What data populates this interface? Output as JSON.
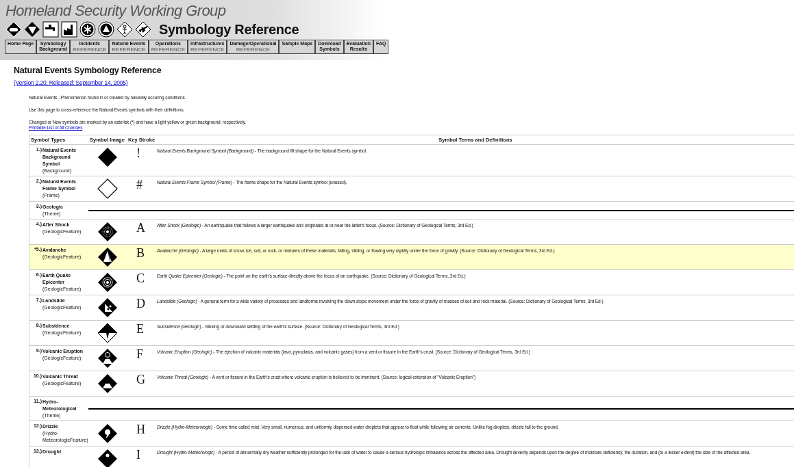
{
  "banner": {
    "title": "Homeland Security Working Group",
    "subtitle": "Symbology Reference"
  },
  "nav": [
    {
      "label": "Home Page"
    },
    {
      "label": "Symbology\nBackground"
    },
    {
      "label": "Incidents",
      "sub": "REFERENCE"
    },
    {
      "label": "Natural Events",
      "sub": "REFERENCE"
    },
    {
      "label": "Operations",
      "sub": "REFERENCE"
    },
    {
      "label": "Infrastructures",
      "sub": "REFERENCE"
    },
    {
      "label": "Damage/Operational",
      "sub": "REFERENCE"
    },
    {
      "label": "Sample Maps"
    },
    {
      "label": "Download\nSymbols"
    },
    {
      "label": "Evaluation\nResults"
    },
    {
      "label": "FAQ"
    }
  ],
  "heading": "Natural Events Symbology Reference",
  "version_link": "(Version 2.20, Released: September 14, 2005)",
  "intro": [
    "Natural Events - Phenomenon found in or created by naturally occuring conditions.",
    "Use this page to cross-reference the Natural Events symbols with their definitions.",
    "Changed or New symbols are marked by an asterisk (*) and have a light yellow or green background, respectively."
  ],
  "changes_link": "Printable List of All Changes",
  "table": {
    "columns": [
      "Symbol Types",
      "Symbol Image",
      "Key Stroke",
      "Symbol Terms and Definitions"
    ],
    "rows": [
      {
        "kind": "symbol",
        "number": "1.)",
        "name": "Natural Events Background Symbol",
        "type": "(Background)",
        "key": "!",
        "changed": false,
        "definition": "*Natural Events Background Symbol (Background)* - The background fill shape for the Natural Events symbol."
      },
      {
        "kind": "symbol",
        "number": "2.)",
        "name": "Natural Events Frame Symbol",
        "type": "(Frame)",
        "key": "#",
        "changed": false,
        "definition": "*Natural Events Frame Symbol (Frame)* - The frame shape for the Natural Events symbol (unused)."
      },
      {
        "kind": "theme",
        "number": "3.)",
        "name": "Geologic",
        "type": "(Theme)"
      },
      {
        "kind": "symbol",
        "number": "4.)",
        "name": "After Shock",
        "type": "(GeologicFeature)",
        "key": "A",
        "changed": false,
        "definition": "*After Shock (Geologic)* - An earthquake that follows a larger earthquake and originates at or near the latter's focus. (Source: Dictionary of Geological Terms, 3rd Ed.)"
      },
      {
        "kind": "symbol",
        "number": "*5.)",
        "name": "Avalanche",
        "type": "(GeologicFeature)",
        "key": "B",
        "changed": true,
        "definition": "*Avalanche (Geologic)* - A large mass of snow, ice, soil, or rock, or mixtures of these materials, falling, sliding, or flowing very rapidly under the force of gravity. (Source: Dictionary of Geological Terms, 3rd Ed.)"
      },
      {
        "kind": "symbol",
        "number": "6.)",
        "name": "Earth Quake Epicenter",
        "type": "(GeologicFeature)",
        "key": "C",
        "changed": false,
        "definition": "*Earth Quake Epicenter (Geologic)* - The point on the earth's surface directly above the focus of an earthquake. (Source: Dictionary of Geological Terms, 3rd Ed.)"
      },
      {
        "kind": "symbol",
        "number": "7.)",
        "name": "Landslide",
        "type": "(GeologicFeature)",
        "key": "D",
        "changed": false,
        "definition": "*Landslide (Geologic)* - A general term for a wide variety of processes and landforms involving the down slope movement under the force of gravity of masses of soil and rock material. (Source: Dictionary of Geological Terms, 3rd Ed.)"
      },
      {
        "kind": "symbol",
        "number": "8.)",
        "name": "Subsidence",
        "type": "(GeologicFeature)",
        "key": "E",
        "changed": false,
        "definition": "*Subsidence (Geologic)* - Sinking or downward settling of the earth's surface. (Source: Dictionary of Geological Terms, 3rd Ed.)"
      },
      {
        "kind": "symbol",
        "number": "9.)",
        "name": "Volcanic Eruption",
        "type": "(GeologicFeature)",
        "key": "F",
        "changed": false,
        "definition": "*Volcanic Eruption (Geologic)* - The ejection of volcanic materials (lava, pyroclasts, and volcanic gases) from a vent or fissure in the Earth's crust. (Source: Dictionary of Geological Terms, 3rd Ed.)"
      },
      {
        "kind": "symbol",
        "number": "10.)",
        "name": "Volcanic Threat",
        "type": "(GeologicFeature)",
        "key": "G",
        "changed": false,
        "definition": "*Volcanic Threat (Geologic)* - A vent or fissure in the Earth's crust where volcanic eruption is believed to be imminent. (Source: logical extension of \"Volcanic Eruption\")"
      },
      {
        "kind": "theme",
        "number": "11.)",
        "name": "Hydro-Meteorological",
        "type": "(Theme)"
      },
      {
        "kind": "symbol",
        "number": "12.)",
        "name": "Drizzle",
        "type": "(Hydro-MeteorologicFeature)",
        "key": "H",
        "changed": false,
        "definition": "*Drizzle (Hydro-Meteorologic)* - Some time called mist. Very small, numerous, and uniformly dispersed water droplets that appear to float while following air currents. Unlike fog droplets, drizzle fall to the ground."
      },
      {
        "kind": "symbol",
        "number": "13.)",
        "name": "Drought",
        "key": "I",
        "changed": false,
        "definition": "*Drought (Hydro-Meteorologic)* - A period of abnormally dry weather sufficiently prolonged for the lack of water to cause a serious hydrologic imbalance across the affected area. Drought severity depends upon the degree of moisture deficiency, the duration, and (to a lesser extent) the size of the affected area."
      }
    ]
  }
}
